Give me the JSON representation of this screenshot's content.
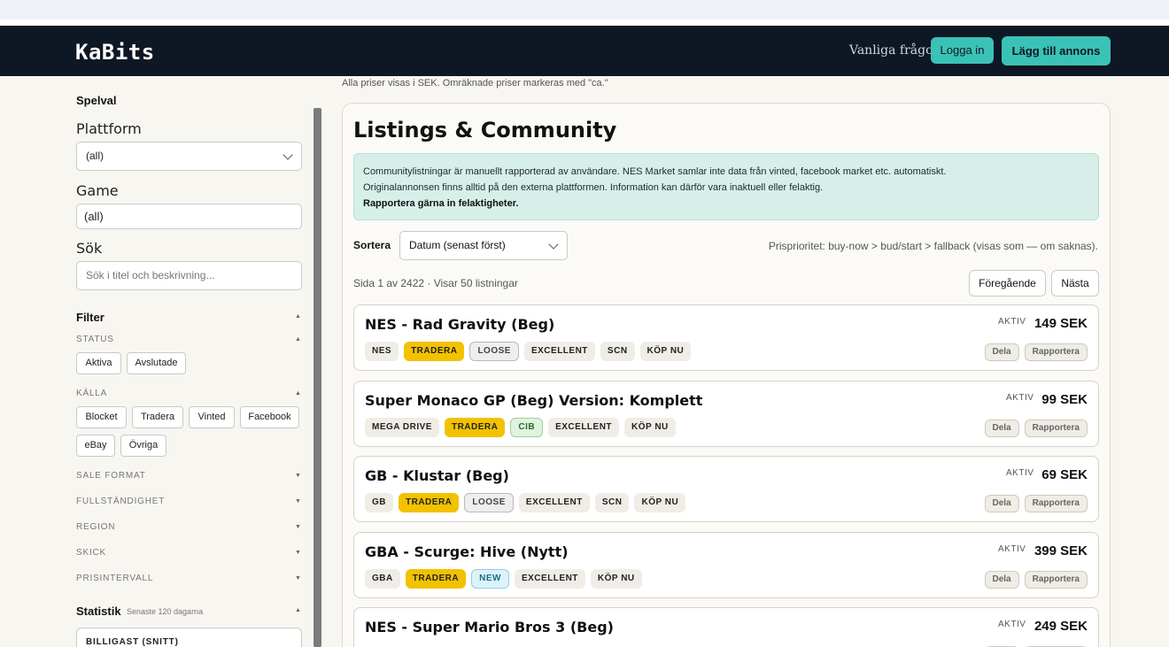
{
  "header": {
    "logo": "KaBits",
    "faq": "Vanliga frågor",
    "login": "Logga in",
    "add_listing": "Lägg till annons"
  },
  "sidebar": {
    "game_select_title": "Spelval",
    "platform_label": "Plattform",
    "platform_value": "(all)",
    "game_label": "Game",
    "game_value": "(all)",
    "search_label": "Sök",
    "search_placeholder": "Sök i titel och beskrivning...",
    "filter_title": "Filter",
    "status_head": "STATUS",
    "status_chips": [
      "Aktiva",
      "Avslutade"
    ],
    "source_head": "KÄLLA",
    "source_chips": [
      "Blocket",
      "Tradera",
      "Vinted",
      "Facebook",
      "eBay",
      "Övriga"
    ],
    "collapsed_sections": [
      "SALE FORMAT",
      "FULLSTÄNDIGHET",
      "REGION",
      "SKICK",
      "PRISINTERVALL"
    ],
    "stats_title": "Statistik",
    "stats_sub": "Senaste 120 dagarna",
    "stats_box": "BILLIGAST (SNITT)"
  },
  "main": {
    "currency_note": "Alla priser visas i SEK. Omräknade priser markeras med \"ca.\"",
    "title": "Listings & Community",
    "info_line1": "Communitylistningar är manuellt rapporterad av användare. NES Market samlar inte data från vinted, facebook market etc. automatiskt.",
    "info_line2": "Originalannonsen finns alltid på den externa plattformen. Information kan därför vara inaktuell eller felaktig.",
    "info_line3": "Rapportera gärna in felaktigheter.",
    "sort_label": "Sortera",
    "sort_value": "Datum (senast först)",
    "price_priority": "Prisprioritet: buy-now > bud/start > fallback (visas som — om saknas).",
    "page_info": "Sida 1 av 2422 · Visar 50 listningar",
    "prev": "Föregående",
    "next": "Nästa",
    "share": "Dela",
    "report": "Rapportera",
    "listings": [
      {
        "title": "NES - Rad Gravity (Beg)",
        "status": "AKTIV",
        "price": "149 SEK",
        "tags": [
          "NES",
          "TRADERA",
          "LOOSE",
          "EXCELLENT",
          "SCN",
          "KÖP NU"
        ]
      },
      {
        "title": "Super Monaco GP (Beg) Version: Komplett",
        "status": "AKTIV",
        "price": "99 SEK",
        "tags": [
          "MEGA DRIVE",
          "TRADERA",
          "CIB",
          "EXCELLENT",
          "KÖP NU"
        ]
      },
      {
        "title": "GB - Klustar (Beg)",
        "status": "AKTIV",
        "price": "69 SEK",
        "tags": [
          "GB",
          "TRADERA",
          "LOOSE",
          "EXCELLENT",
          "SCN",
          "KÖP NU"
        ]
      },
      {
        "title": "GBA - Scurge: Hive (Nytt)",
        "status": "AKTIV",
        "price": "399 SEK",
        "tags": [
          "GBA",
          "TRADERA",
          "NEW",
          "EXCELLENT",
          "KÖP NU"
        ]
      },
      {
        "title": "NES - Super Mario Bros 3 (Beg)",
        "status": "AKTIV",
        "price": "249 SEK",
        "tags": []
      }
    ]
  },
  "colors": {
    "header_bg": "#0e1724",
    "accent": "#3bc2b6",
    "tradera": "#f2c200",
    "info_bg": "#d7efe9"
  }
}
